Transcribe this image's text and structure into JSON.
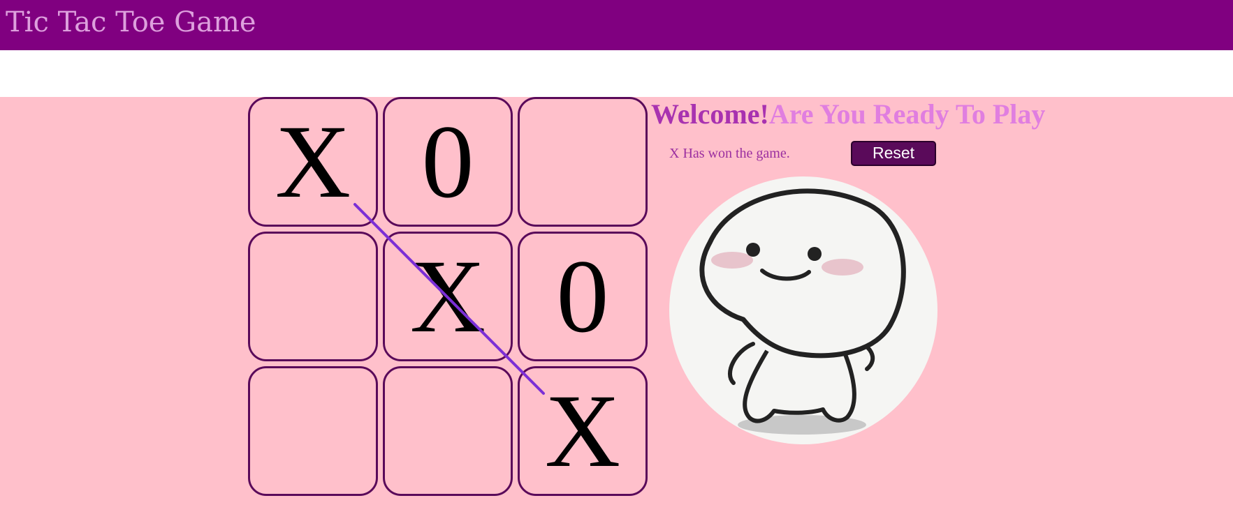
{
  "header": {
    "title": "Tic Tac Toe Game",
    "bg_color": "#800080",
    "title_color": "#dda0dd"
  },
  "game": {
    "board_bg": "#ffc0cb",
    "cells": [
      "X",
      "0",
      "",
      "",
      "X",
      "0",
      "",
      "",
      "X"
    ],
    "win_line_color": "#7b2fd6",
    "welcome_part1": "Welcome!",
    "welcome_part2": "Are You Ready To Play",
    "status": "X Has won the game.",
    "reset_label": "Reset",
    "mascot_icon": "smiling-character-icon"
  }
}
